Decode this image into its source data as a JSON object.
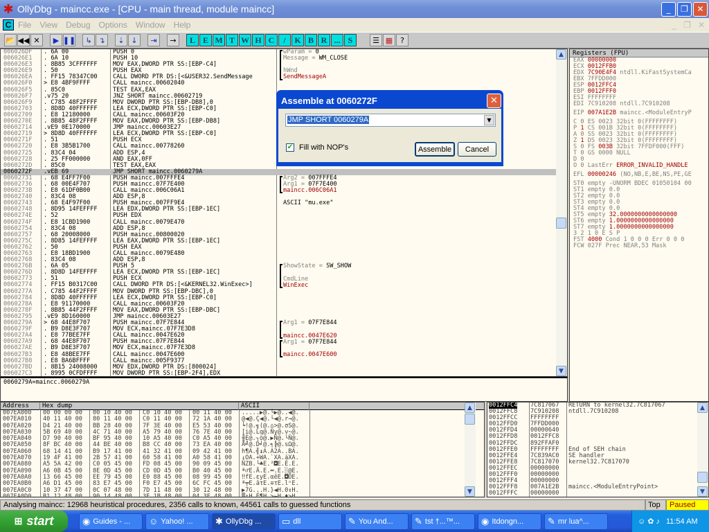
{
  "window": {
    "title": "OllyDbg - maincc.exe - [CPU - main thread, module maincc]",
    "controls": [
      "minimize",
      "restore",
      "close"
    ]
  },
  "menu": {
    "items": [
      "File",
      "View",
      "Debug",
      "Options",
      "Window",
      "Help"
    ]
  },
  "toolbar": {
    "buttons": [
      {
        "name": "open",
        "glyph": "📂"
      },
      {
        "name": "restart",
        "glyph": "◀◀"
      },
      {
        "name": "close",
        "glyph": "✕"
      },
      {
        "name": "run",
        "glyph": "▶"
      },
      {
        "name": "pause",
        "glyph": "❚❚"
      },
      {
        "name": "step-into",
        "glyph": "↳"
      },
      {
        "name": "step-over",
        "glyph": "↴"
      },
      {
        "name": "trace-into",
        "glyph": "⇣"
      },
      {
        "name": "trace-over",
        "glyph": "↓"
      },
      {
        "name": "execute-till-return",
        "glyph": "⇥"
      },
      {
        "name": "go-to-address",
        "glyph": "→"
      }
    ],
    "letters": [
      "L",
      "E",
      "M",
      "T",
      "W",
      "H",
      "C",
      "/",
      "K",
      "B",
      "R",
      "...",
      "S"
    ],
    "extra": [
      {
        "name": "options",
        "glyph": "☰"
      },
      {
        "name": "appearance",
        "glyph": "▦"
      },
      {
        "name": "help",
        "glyph": "?"
      }
    ]
  },
  "disasm": {
    "rows": [
      {
        "addr": "006026DF",
        "hex": ". 6A 00",
        "asm": "PUSH 0"
      },
      {
        "addr": "006026E1",
        "hex": ". 6A 10",
        "asm": "PUSH 10"
      },
      {
        "addr": "006026E3",
        "hex": ". 8B85 3CFFFFFF",
        "asm": "MOV EAX,DWORD PTR SS:[EBP-C4]"
      },
      {
        "addr": "006026E9",
        "hex": ". 50",
        "asm": "PUSH EAX"
      },
      {
        "addr": "006026EA",
        "hex": ". FF15 78347C00",
        "asm": "CALL DWORD PTR DS:[<&USER32.SendMessage"
      },
      {
        "addr": "006026F0",
        "hex": "> E8 4BF9FFFF",
        "asm": "CALL maincc.00602040"
      },
      {
        "addr": "006026F5",
        "hex": ". 85C0",
        "asm": "TEST EAX,EAX"
      },
      {
        "addr": "006026F7",
        "hex": ".v75 20",
        "asm": "JNZ SHORT maincc.00602719"
      },
      {
        "addr": "006026F9",
        "hex": ". C785 48F2FFFF",
        "asm": "MOV DWORD PTR SS:[EBP-DB8],0"
      },
      {
        "addr": "00602703",
        "hex": ". 8D8D 40FFFFFF",
        "asm": "LEA ECX,DWORD PTR SS:[EBP-C0]"
      },
      {
        "addr": "00602709",
        "hex": ". E8 12180000",
        "asm": "CALL maincc.00603F20"
      },
      {
        "addr": "0060270E",
        "hex": ". 8B85 48F2FFFF",
        "asm": "MOV EAX,DWORD PTR SS:[EBP-DB8]"
      },
      {
        "addr": "00602714",
        "hex": ".vE9 0E170000",
        "asm": "JMP maincc.00603E27"
      },
      {
        "addr": "00602719",
        "hex": "> 8D8D 40FFFFFF",
        "asm": "LEA ECX,DWORD PTR SS:[EBP-C0]"
      },
      {
        "addr": "0060271F",
        "hex": ". 51",
        "asm": "PUSH ECX"
      },
      {
        "addr": "00602720",
        "hex": ". E8 3B5B1700",
        "asm": "CALL maincc.00778260"
      },
      {
        "addr": "00602725",
        "hex": ". 83C4 04",
        "asm": "ADD ESP,4"
      },
      {
        "addr": "00602728",
        "hex": ". 25 FF000000",
        "asm": "AND EAX,0FF"
      },
      {
        "addr": "0060272D",
        "hex": ". 85C0",
        "asm": "TEST EAX,EAX"
      },
      {
        "addr": "0060272F",
        "hex": ".vEB 69",
        "asm": "JMP SHORT maincc.0060279A",
        "selected": true
      },
      {
        "addr": "00602731",
        "hex": ". 68 E4FF7F00",
        "asm": "PUSH maincc.007FFFE4"
      },
      {
        "addr": "00602736",
        "hex": ". 68 00E4F707",
        "asm": "PUSH maincc.07F7E400"
      },
      {
        "addr": "0060273B",
        "hex": ". E8 61DF0B00",
        "asm": "CALL maincc.006C06A1"
      },
      {
        "addr": "00602740",
        "hex": ". 83C4 08",
        "asm": "ADD ESP,8"
      },
      {
        "addr": "00602743",
        "hex": ". 68 E4F97F00",
        "asm": "PUSH maincc.007FF9E4"
      },
      {
        "addr": "00602748",
        "hex": ". 8D95 14FEFFFF",
        "asm": "LEA EDX,DWORD PTR SS:[EBP-1EC]"
      },
      {
        "addr": "0060274E",
        "hex": ". 52",
        "asm": "PUSH EDX"
      },
      {
        "addr": "0060274F",
        "hex": ". E8 1CBD1900",
        "asm": "CALL maincc.0079E470"
      },
      {
        "addr": "00602754",
        "hex": ". 83C4 08",
        "asm": "ADD ESP,8"
      },
      {
        "addr": "00602757",
        "hex": ". 68 20008000",
        "asm": "PUSH maincc.00800020"
      },
      {
        "addr": "0060275C",
        "hex": ". 8D85 14FEFFFF",
        "asm": "LEA EAX,DWORD PTR SS:[EBP-1EC]"
      },
      {
        "addr": "00602762",
        "hex": ". 50",
        "asm": "PUSH EAX"
      },
      {
        "addr": "00602763",
        "hex": ". E8 18BD1900",
        "asm": "CALL maincc.0079E480"
      },
      {
        "addr": "00602768",
        "hex": ". 83C4 08",
        "asm": "ADD ESP,8"
      },
      {
        "addr": "0060276B",
        "hex": ". 6A 05",
        "asm": "PUSH 5"
      },
      {
        "addr": "0060276D",
        "hex": ". 8D8D 14FEFFFF",
        "asm": "LEA ECX,DWORD PTR SS:[EBP-1EC]"
      },
      {
        "addr": "00602773",
        "hex": ". 51",
        "asm": "PUSH ECX"
      },
      {
        "addr": "00602774",
        "hex": ". FF15 B0317C00",
        "asm": "CALL DWORD PTR DS:[<&KERNEL32.WinExec>]"
      },
      {
        "addr": "0060277A",
        "hex": ". C785 44F2FFFF",
        "asm": "MOV DWORD PTR SS:[EBP-DBC],0"
      },
      {
        "addr": "00602784",
        "hex": ". 8D8D 40FFFFFF",
        "asm": "LEA ECX,DWORD PTR SS:[EBP-C0]"
      },
      {
        "addr": "0060278A",
        "hex": ". E8 91170000",
        "asm": "CALL maincc.00603F20"
      },
      {
        "addr": "0060278F",
        "hex": ". 8B85 44F2FFFF",
        "asm": "MOV EAX,DWORD PTR SS:[EBP-DBC]"
      },
      {
        "addr": "00602795",
        "hex": ".vE9 8D160000",
        "asm": "JMP maincc.00603E27"
      },
      {
        "addr": "0060279A",
        "hex": "> 68 44E8F707",
        "asm": "PUSH maincc.07F7E844"
      },
      {
        "addr": "0060279F",
        "hex": ". B9 D8E3F707",
        "asm": "MOV ECX,maincc.07F7E3D8"
      },
      {
        "addr": "006027A4",
        "hex": ". E8 77BEE7FF",
        "asm": "CALL maincc.0047E620"
      },
      {
        "addr": "006027A9",
        "hex": ". 68 44E8F707",
        "asm": "PUSH maincc.07F7E844"
      },
      {
        "addr": "006027AE",
        "hex": ". B9 D8E3F707",
        "asm": "MOV ECX,maincc.07F7E3D8"
      },
      {
        "addr": "006027B3",
        "hex": ". E8 48BEE7FF",
        "asm": "CALL maincc.0047E600"
      },
      {
        "addr": "006027B8",
        "hex": ". E8 BA6BFFFF",
        "asm": "CALL maincc.005F9377"
      },
      {
        "addr": "006027BD",
        "hex": ". 8B15 24008000",
        "asm": "MOV EDX,DWORD PTR DS:[800024]"
      },
      {
        "addr": "006027C3",
        "hex": ". 8995 0CFDFFFF",
        "asm": "MOV DWORD PTR SS:[EBP-2F4],EDX"
      }
    ]
  },
  "comments": [
    {
      "row": 0,
      "label": "wParam = ",
      "value": "0"
    },
    {
      "row": 1,
      "label": "Message = ",
      "value": "WM_CLOSE"
    },
    {
      "row": 3,
      "label": "hWnd",
      "value": ""
    },
    {
      "row": 4,
      "label": "",
      "value": "SendMessageA",
      "red": true
    },
    {
      "row": 20,
      "label": "Arg2 = ",
      "value": "007FFFE4"
    },
    {
      "row": 21,
      "label": "Arg1 = ",
      "value": "07F7E400"
    },
    {
      "row": 22,
      "label": "maincc.",
      "value": "006C06A1",
      "red": true
    },
    {
      "row": 24,
      "label": "",
      "value": "ASCII \"mu.exe\""
    },
    {
      "row": 34,
      "label": "ShowState = ",
      "value": "SW_SHOW"
    },
    {
      "row": 36,
      "label": "CmdLine",
      "value": ""
    },
    {
      "row": 37,
      "label": "",
      "value": "WinExec",
      "red": true
    },
    {
      "row": 43,
      "label": "Arg1 = ",
      "value": "07F7E844"
    },
    {
      "row": 45,
      "label": "maincc.",
      "value": "0047E620",
      "red": true
    },
    {
      "row": 46,
      "label": "Arg1 = ",
      "value": "07F7E844"
    },
    {
      "row": 48,
      "label": "maincc.",
      "value": "0047E600",
      "red": true
    }
  ],
  "info": {
    "text": "0060279A=maincc.0060279A"
  },
  "registers": {
    "header": "Registers (FPU)",
    "gp": [
      {
        "name": "EAX",
        "value": "00000000",
        "changed": true,
        "note": ""
      },
      {
        "name": "ECX",
        "value": "0012FFB0",
        "changed": true,
        "note": ""
      },
      {
        "name": "EDX",
        "value": "7C90E4F4",
        "changed": true,
        "note": "ntdll.KiFastSystemCa"
      },
      {
        "name": "EBX",
        "value": "7FFDD000",
        "changed": false,
        "note": ""
      },
      {
        "name": "ESP",
        "value": "0012FFC4",
        "changed": true,
        "note": ""
      },
      {
        "name": "EBP",
        "value": "0012FFF0",
        "changed": true,
        "note": ""
      },
      {
        "name": "ESI",
        "value": "FFFFFFFF",
        "changed": false,
        "note": ""
      },
      {
        "name": "EDI",
        "value": "7C910208",
        "changed": false,
        "note": "ntdll.7C910208"
      }
    ],
    "eip": {
      "name": "EIP",
      "value": "007A1E2B",
      "note": "maincc.<ModuleEntryP"
    },
    "flags": [
      {
        "f": "C",
        "v": "0",
        "seg": "ES",
        "sv": "0023",
        "bits": "32bit",
        "base": "0(FFFFFFFF)"
      },
      {
        "f": "P",
        "v": "1",
        "seg": "CS",
        "sv": "001B",
        "bits": "32bit",
        "base": "0(FFFFFFFF)"
      },
      {
        "f": "A",
        "v": "0",
        "seg": "SS",
        "sv": "0023",
        "bits": "32bit",
        "base": "0(FFFFFFFF)"
      },
      {
        "f": "Z",
        "v": "1",
        "seg": "DS",
        "sv": "0023",
        "bits": "32bit",
        "base": "0(FFFFFFFF)"
      },
      {
        "f": "S",
        "v": "0",
        "seg": "FS",
        "sv": "003B",
        "bits": "32bit",
        "base": "7FFDF000(FFF)"
      },
      {
        "f": "T",
        "v": "0",
        "seg": "GS",
        "sv": "0000",
        "bits": "NULL",
        "base": ""
      },
      {
        "f": "D",
        "v": "0",
        "seg": "",
        "sv": "",
        "bits": "",
        "base": ""
      },
      {
        "f": "O",
        "v": "0",
        "seg": "",
        "sv": "",
        "bits": "",
        "base": ""
      }
    ],
    "lasterr": {
      "label": "LastErr",
      "value": "ERROR_INVALID_HANDLE"
    },
    "efl": {
      "name": "EFL",
      "value": "00000246",
      "note": "(NO,NB,E,BE,NS,PE,GE"
    },
    "fpu": [
      {
        "name": "ST0",
        "tag": "empty",
        "value": "-UNORM BDEC 01050104 00",
        "red": false
      },
      {
        "name": "ST1",
        "tag": "empty",
        "value": "0.0",
        "red": false
      },
      {
        "name": "ST2",
        "tag": "empty",
        "value": "0.0",
        "red": false
      },
      {
        "name": "ST3",
        "tag": "empty",
        "value": "0.0",
        "red": false
      },
      {
        "name": "ST4",
        "tag": "empty",
        "value": "0.0",
        "red": false
      },
      {
        "name": "ST5",
        "tag": "empty",
        "value": "32.0000000000000000",
        "red": true
      },
      {
        "name": "ST6",
        "tag": "empty",
        "value": "1.0000000000000000",
        "red": true
      },
      {
        "name": "ST7",
        "tag": "empty",
        "value": "1.0000000000000000",
        "red": true
      }
    ],
    "cond_header": "3 2 1 0      E S P",
    "fst": {
      "name": "FST",
      "value": "4000",
      "rest": "Cond 1 0 0 0  Err 0 0 0"
    },
    "fcw": {
      "name": "FCW",
      "value": "027F",
      "rest": "Prec NEAR,53  Mask"
    }
  },
  "dump": {
    "headers": [
      "Address",
      "Hex dump",
      "ASCII"
    ],
    "rows": [
      {
        "addr": "007EA000",
        "hex": "00 00 00 00 00 10 40 00 C0 10 40 00 00 11 40 00",
        "ascii": ".....▶@.└▶@..◀@."
      },
      {
        "addr": "007EA010",
        "hex": "40 11 40 00 80 11 40 00 C0 11 40 00 72 1A 40 00",
        "ascii": "@◀@.Ç◀@.└◀@.r→@."
      },
      {
        "addr": "007EA020",
        "hex": "D4 21 40 00 BB 28 40 00 7F 3E 40 00 E5 53 40 00",
        "ascii": "╘!@.╗(@.⌂>@.σS@."
      },
      {
        "addr": "007EA030",
        "hex": "5B 69 40 00 4C 71 40 00 A5 79 40 00 76 7E 40 00",
        "ascii": "[i@.Lq@.Ñy@.v~@."
      },
      {
        "addr": "007EA040",
        "hex": "D7 90 40 00 BF 95 40 00 10 A5 40 00 C0 A5 40 00",
        "ascii": "╫É@.┐ò@.▶Ñ@.└Ñ@."
      },
      {
        "addr": "007EA050",
        "hex": "8F BC 40 00 44 BE 40 00 B8 CC 40 00 73 EA 40 00",
        "ascii": "Å╝@.D╛@.╕╠@.sΩ@."
      },
      {
        "addr": "007EA060",
        "hex": "68 14 41 00 B9 17 41 00 41 32 41 00 09 42 41 00",
        "ascii": "h¶A.╣↨A.A2A..BA."
      },
      {
        "addr": "007EA070",
        "hex": "19 4F 41 00 2B 57 41 00 60 58 41 00 A0 58 41 00",
        "ascii": "↓OA.+WA.`XA.áXA."
      },
      {
        "addr": "007EA080",
        "hex": "A5 5A 42 00 C0 05 45 00 FD 08 45 00 90 09 45 00",
        "ascii": "ÑZB.└♣E.²◘E.É.E."
      },
      {
        "addr": "007EA090",
        "hex": "A6 0B 45 00 8E 0D 45 00 CD 0D 45 00 B0 40 45 00",
        "ascii": "ª♂E.Ä.E.═.E.░@E."
      },
      {
        "addr": "007EA0A0",
        "hex": "13 66 45 00 EE 79 45 00 E0 88 45 00 08 99 45 00",
        "ascii": "‼fE.εyE.αêE.◘ÖE."
      },
      {
        "addr": "007EA0B0",
        "hex": "A6 D1 45 00 83 E7 45 00 F0 E7 45 00 6C FC 45 00",
        "ascii": "ª╤E.âτE.≡τE.lⁿE."
      },
      {
        "addr": "007EA0C0",
        "hex": "10 37 47 00 0C 07 48 00 7D 11 48 00 30 12 48 00",
        "ascii": "▶7G...H.}◀H.0↕H."
      },
      {
        "addr": "007EA0D0",
        "hex": "B1 12 48 00 90 14 48 00 3E 1B 48 00 04 3E 48 00",
        "ascii": "▒↕H.É¶H.>←H.♦>H."
      }
    ]
  },
  "stack": {
    "rows": [
      {
        "addr": "0012FFC4",
        "val": "7C817067",
        "cmt": "RETURN to kernel32.7C817067",
        "selected": true
      },
      {
        "addr": "0012FFC8",
        "val": "7C910208",
        "cmt": "ntdll.7C910208"
      },
      {
        "addr": "0012FFCC",
        "val": "FFFFFFFF",
        "cmt": ""
      },
      {
        "addr": "0012FFD0",
        "val": "7FFDD000",
        "cmt": ""
      },
      {
        "addr": "0012FFD4",
        "val": "00000640",
        "cmt": ""
      },
      {
        "addr": "0012FFD8",
        "val": "0012FFC8",
        "cmt": ""
      },
      {
        "addr": "0012FFDC",
        "val": "892FFAF0",
        "cmt": ""
      },
      {
        "addr": "0012FFE0",
        "val": "FFFFFFFF",
        "cmt": "End of SEH chain"
      },
      {
        "addr": "0012FFE4",
        "val": "7C839AC0",
        "cmt": "SE handler"
      },
      {
        "addr": "0012FFE8",
        "val": "7C817070",
        "cmt": "kernel32.7C817070"
      },
      {
        "addr": "0012FFEC",
        "val": "00000000",
        "cmt": ""
      },
      {
        "addr": "0012FFF0",
        "val": "00000000",
        "cmt": ""
      },
      {
        "addr": "0012FFF4",
        "val": "00000000",
        "cmt": ""
      },
      {
        "addr": "0012FFF8",
        "val": "007A1E2B",
        "cmt": "maincc.<ModuleEntryPoint>"
      },
      {
        "addr": "0012FFFC",
        "val": "00000000",
        "cmt": ""
      }
    ]
  },
  "dialog": {
    "title": "Assemble at 0060272F",
    "command": "JMP SHORT 0060279A",
    "fill_nops_label": "Fill with NOP's",
    "fill_nops_checked": true,
    "assemble_label": "Assemble",
    "cancel_label": "Cancel"
  },
  "status": {
    "message": "Analysing maincc: 12968 heuristical procedures, 2356 calls to known, 44561 calls to guessed functions",
    "topmost": "Top",
    "state": "Paused"
  },
  "taskbar": {
    "start_label": "start",
    "tasks": [
      {
        "label": "Guides - ...",
        "icon": "firefox-icon",
        "glyph": "◉",
        "active": false
      },
      {
        "label": "Yahoo! ...",
        "icon": "yahoo-messenger-icon",
        "glyph": "☺",
        "active": false
      },
      {
        "label": "OllyDbg ...",
        "icon": "ollydbg-icon",
        "glyph": "✱",
        "active": true
      },
      {
        "label": "dll",
        "icon": "folder-icon",
        "glyph": "▭",
        "active": false
      },
      {
        "label": "You And...",
        "icon": "chat-icon",
        "glyph": "✎",
        "active": false
      },
      {
        "label": "tst †...™...",
        "icon": "chat-icon",
        "glyph": "✎",
        "active": false
      },
      {
        "label": "Itdongn...",
        "icon": "firefox-icon",
        "glyph": "◉",
        "active": false
      },
      {
        "label": "mr lua^...",
        "icon": "chat-icon",
        "glyph": "✎",
        "active": false
      }
    ],
    "clock": "11:54 AM"
  },
  "colors": {
    "changed_register": "#a00000",
    "paused_bg": "#ffff00",
    "selection_bg": "#316ac5"
  }
}
